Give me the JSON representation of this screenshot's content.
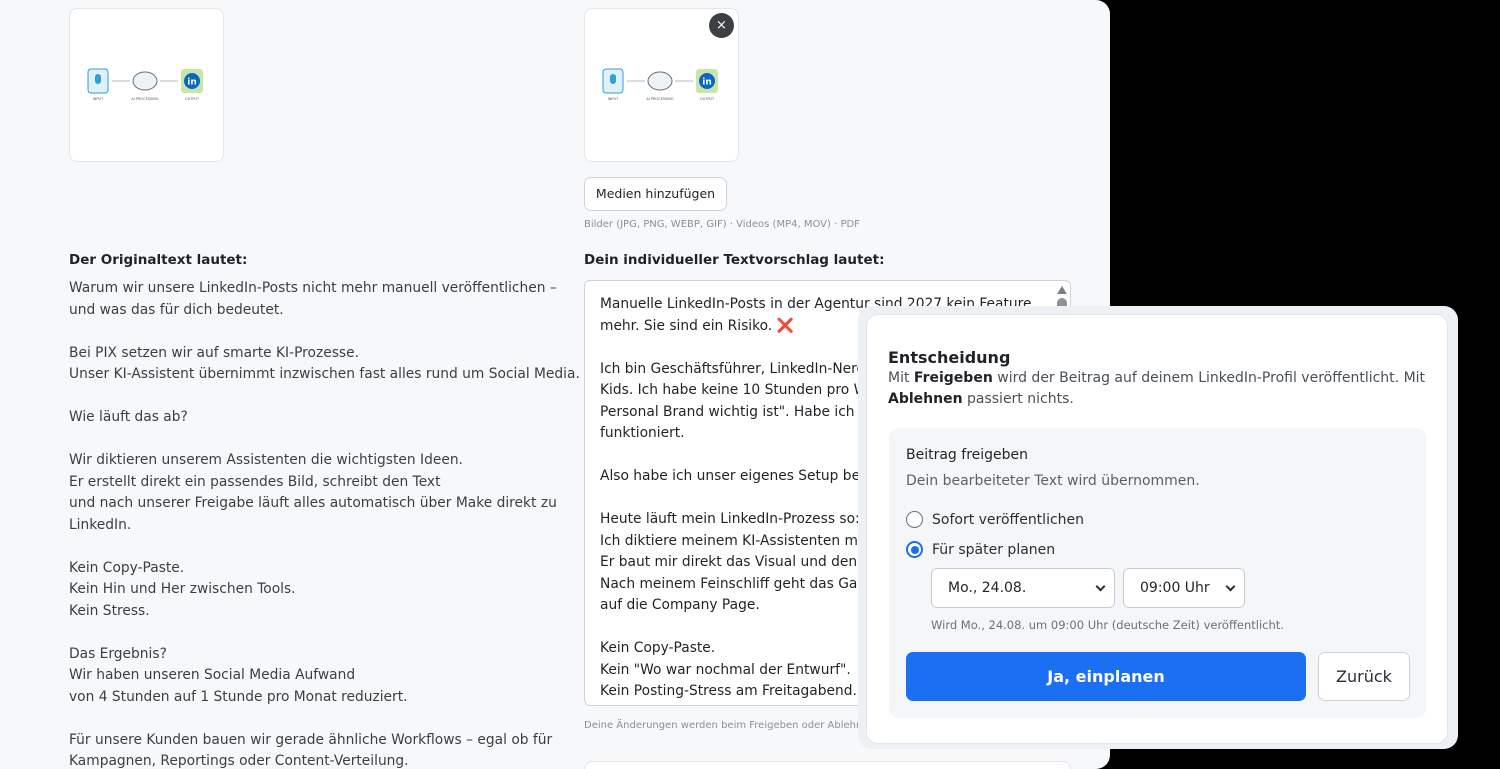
{
  "media": {
    "thumb_labels": [
      "INPUT",
      "AI PROCESSING",
      "OUTPUT"
    ],
    "remove_label": "×",
    "add_button_label": "Medien hinzufügen",
    "formats_hint": "Bilder (JPG, PNG, WEBP, GIF) · Videos (MP4, MOV) · PDF"
  },
  "original": {
    "heading": "Der Originaltext lautet:",
    "text": "Warum wir unsere LinkedIn-Posts nicht mehr manuell veröffentlichen –\nund was das für dich bedeutet.\n\nBei PIX setzen wir auf smarte KI-Prozesse.\nUnser KI-Assistent übernimmt inzwischen fast alles rund um Social Media.\n\nWie läuft das ab?\n\nWir diktieren unserem Assistenten die wichtigsten Ideen.\nEr erstellt direkt ein passendes Bild, schreibt den Text\nund nach unserer Freigabe läuft alles automatisch über Make direkt zu\nLinkedIn.\n\nKein Copy-Paste.\nKein Hin und Her zwischen Tools.\nKein Stress.\n\nDas Ergebnis?\nWir haben unseren Social Media Aufwand\nvon 4 Stunden auf 1 Stunde pro Monat reduziert.\n\nFür unsere Kunden bauen wir gerade ähnliche Workflows – egal ob für\nKampagnen, Reportings oder Content-Verteilung."
  },
  "suggestion": {
    "heading": "Dein individueller Textvorschlag lautet:",
    "text": "Manuelle LinkedIn-Posts in der Agentur sind 2027 kein Feature.\nmehr. Sie sind ein Risiko. ❌\n\nIch bin Geschäftsführer, LinkedIn-Nerd u\nKids. Ich habe keine 10 Stunden pro Woc\nPersonal Brand wichtig ist\". Habe ich frü\nfunktioniert.\n\nAlso habe ich unser eigenes Setup bei P\n\nHeute läuft mein LinkedIn-Prozess so:\nIch diktiere meinem KI-Assistenten meir\nEr baut mir direkt das Visual und den Te\nNach meinem Feinschliff geht das Ganz\nauf die Company Page.\n\nKein Copy-Paste.\nKein \"Wo war nochmal der Entwurf\".\nKein Posting-Stress am Freitagabend.",
    "edit_hint": "Deine Änderungen werden beim Freigeben oder Ablehne"
  },
  "modal": {
    "title": "Entscheidung",
    "desc_prefix": "Mit ",
    "desc_approve": "Freigeben",
    "desc_middle": " wird der Beitrag auf deinem LinkedIn-Profil veröffentlicht. Mit ",
    "desc_reject": "Ablehnen",
    "desc_suffix": " passiert nichts.",
    "option_title": "Beitrag freigeben",
    "option_sub": "Dein bearbeiteter Text wird übernommen.",
    "radio_now": "Sofort veröffentlichen",
    "radio_later": "Für später planen",
    "selected_radio": "later",
    "date_value": "Mo., 24.08.",
    "time_value": "09:00 Uhr",
    "schedule_note": "Wird Mo., 24.08. um 09:00 Uhr (deutsche Zeit) veröffentlicht.",
    "confirm_label": "Ja, einplanen",
    "back_label": "Zurück"
  },
  "colors": {
    "primary": "#1a6ff2",
    "icon_blue": "#2f9fd8",
    "icon_green": "#c8e6a8"
  }
}
